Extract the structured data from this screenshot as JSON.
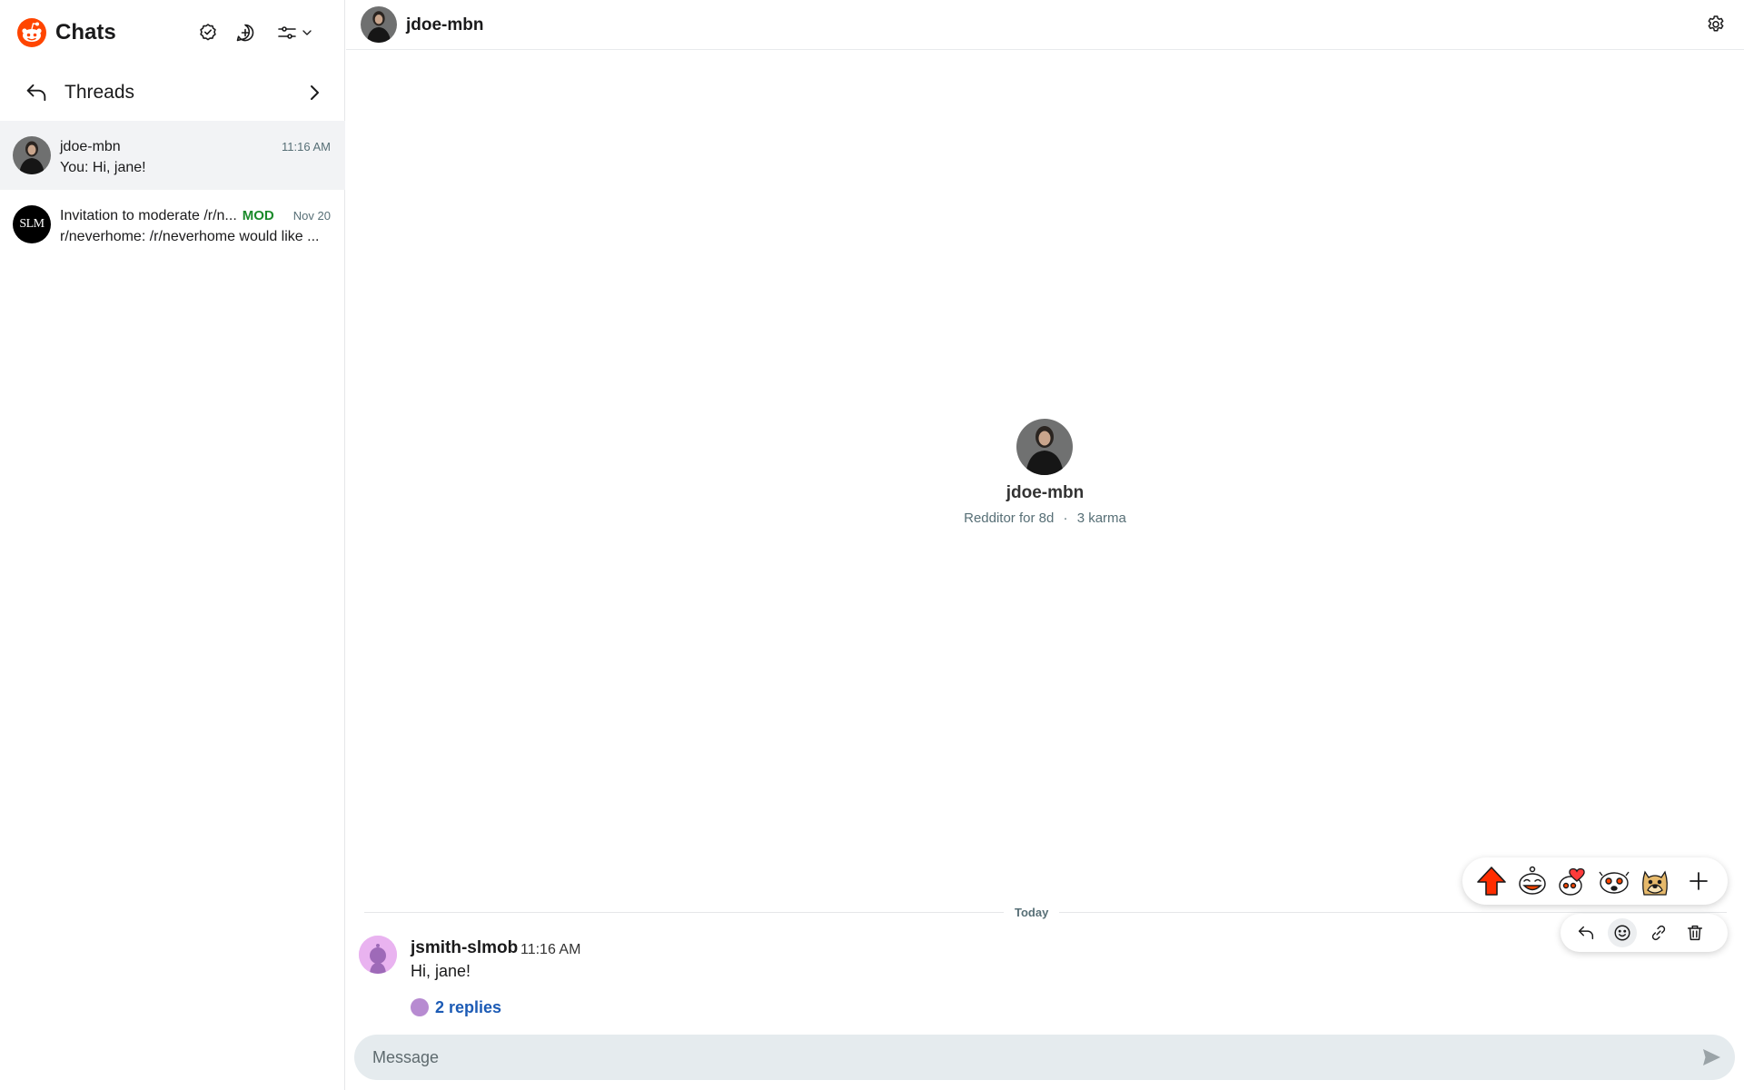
{
  "sidebar": {
    "title": "Chats",
    "threads_label": "Threads",
    "conversations": [
      {
        "name": "jdoe-mbn",
        "time": "11:16 AM",
        "preview": "You: Hi, jane!",
        "active": true
      },
      {
        "name": "Invitation to moderate /r/n...",
        "badge": "MOD",
        "time": "Nov 20",
        "preview": "r/neverhome: /r/neverhome would like ...",
        "avatar_text": "SLM"
      }
    ]
  },
  "header": {
    "name": "jdoe-mbn"
  },
  "profile": {
    "name": "jdoe-mbn",
    "age": "Redditor for 8d",
    "separator": "·",
    "karma": "3 karma"
  },
  "thread": {
    "divider": "Today",
    "message": {
      "author": "jsmith-slmob",
      "time": "11:16 AM",
      "text": "Hi, jane!",
      "replies": "2 replies"
    }
  },
  "reactions": [
    "upvote-icon",
    "snoo-laugh-icon",
    "snoo-hearts-icon",
    "snoo-shocked-icon",
    "doge-icon",
    "add-reaction-icon"
  ],
  "actions": [
    "reply-icon",
    "emoji-icon",
    "link-icon",
    "trash-icon"
  ],
  "composer": {
    "placeholder": "Message"
  },
  "colors": {
    "brand": "#ff4500",
    "mod": "#1a8a2a",
    "link": "#1c5bb5",
    "composer_bg": "#e5ebee",
    "active_row": "#f2f3f5"
  }
}
